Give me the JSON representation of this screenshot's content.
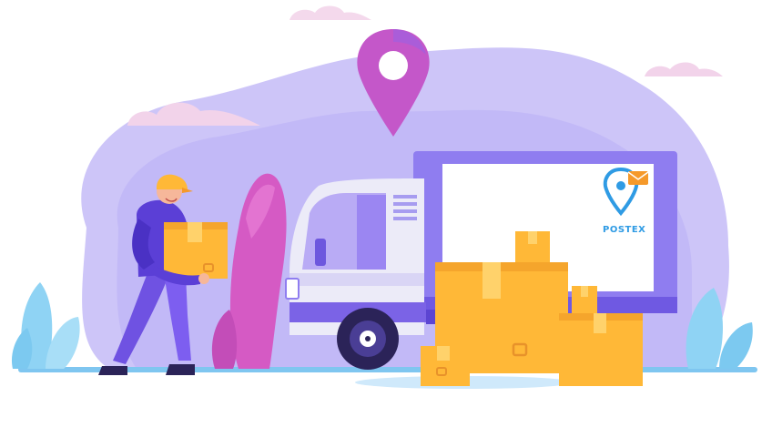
{
  "illustration": {
    "logo_text": "POSTEX",
    "colors": {
      "background_blob": "#c9c2f7",
      "blob_light": "#e2dcfb",
      "cloud": "#f3d6ea",
      "pin": "#d24fb0",
      "pin_highlight": "#a75fe4",
      "truck_body": "#e9e7f8",
      "truck_accent": "#7b63e6",
      "cargo_panel": "#ffffff",
      "cargo_frame": "#8f7df0",
      "box": "#ffb837",
      "box_shade": "#f5992a",
      "ground": "#7fc6f0",
      "plant_blue": "#8fd3f4",
      "plant_pink": "#d45cc3",
      "worker_shirt": "#5b3fd6",
      "worker_pants": "#7d5ef0",
      "worker_cap": "#ffb837",
      "logo_blue": "#2f9be4",
      "logo_orange": "#f5992a"
    },
    "icons": [
      "location-pin-icon",
      "mail-envelope-icon"
    ]
  }
}
